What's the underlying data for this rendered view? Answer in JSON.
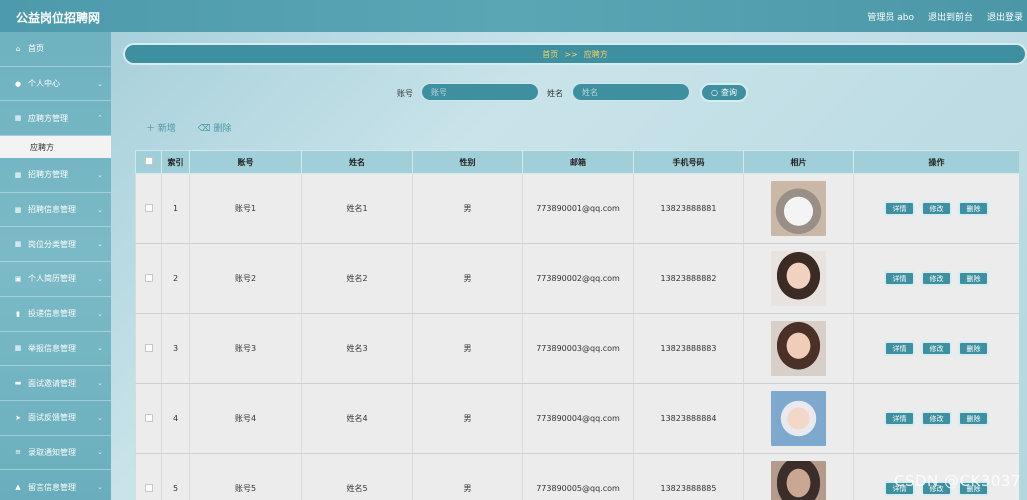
{
  "header": {
    "app_title": "公益岗位招聘网",
    "admin_label": "管理员 abo",
    "goto_front": "退出到前台",
    "logout": "退出登录"
  },
  "sidebar": {
    "items": [
      {
        "label": "首页",
        "icon": "home-icon"
      },
      {
        "label": "个人中心",
        "icon": "user-icon"
      },
      {
        "label": "应聘方管理",
        "icon": "grid-icon"
      },
      {
        "label": "招聘方管理",
        "icon": "grid-icon"
      },
      {
        "label": "招聘信息管理",
        "icon": "grid-icon"
      },
      {
        "label": "岗位分类管理",
        "icon": "grid-icon"
      },
      {
        "label": "个人简历管理",
        "icon": "briefcase-icon"
      },
      {
        "label": "投递信息管理",
        "icon": "chart-icon"
      },
      {
        "label": "举报信息管理",
        "icon": "grid-icon"
      },
      {
        "label": "面试邀请管理",
        "icon": "database-icon"
      },
      {
        "label": "面试反馈管理",
        "icon": "send-icon"
      },
      {
        "label": "录取通知管理",
        "icon": "sliders-icon"
      },
      {
        "label": "留言信息管理",
        "icon": "lock-icon"
      }
    ],
    "active_sub": "应聘方"
  },
  "breadcrumb": {
    "home": "首页",
    "sep": ">>",
    "current": "应聘方"
  },
  "search": {
    "account_label": "账号",
    "account_placeholder": "账号",
    "name_label": "姓名",
    "name_placeholder": "姓名",
    "query_button": "查询"
  },
  "actions": {
    "add": "新增",
    "delete": "删除"
  },
  "table": {
    "headers": [
      "索引",
      "账号",
      "姓名",
      "性别",
      "邮箱",
      "手机号码",
      "相片",
      "操作"
    ],
    "op_labels": {
      "detail": "详情",
      "edit": "修改",
      "remove": "删除"
    },
    "rows": [
      {
        "index": "1",
        "account": "账号1",
        "name": "姓名1",
        "gender": "男",
        "email": "773890001@qq.com",
        "phone": "13823888881"
      },
      {
        "index": "2",
        "account": "账号2",
        "name": "姓名2",
        "gender": "男",
        "email": "773890002@qq.com",
        "phone": "13823888882"
      },
      {
        "index": "3",
        "account": "账号3",
        "name": "姓名3",
        "gender": "男",
        "email": "773890003@qq.com",
        "phone": "13823888883"
      },
      {
        "index": "4",
        "account": "账号4",
        "name": "姓名4",
        "gender": "男",
        "email": "773890004@qq.com",
        "phone": "13823888884"
      },
      {
        "index": "5",
        "account": "账号5",
        "name": "姓名5",
        "gender": "男",
        "email": "773890005@qq.com",
        "phone": "13823888885"
      }
    ]
  },
  "watermark": "CSDN @CK3037",
  "colors": {
    "accent": "#3e8f9f",
    "header_bg": "#a0cfd9",
    "breadcrumb_text": "#f2d36b"
  }
}
